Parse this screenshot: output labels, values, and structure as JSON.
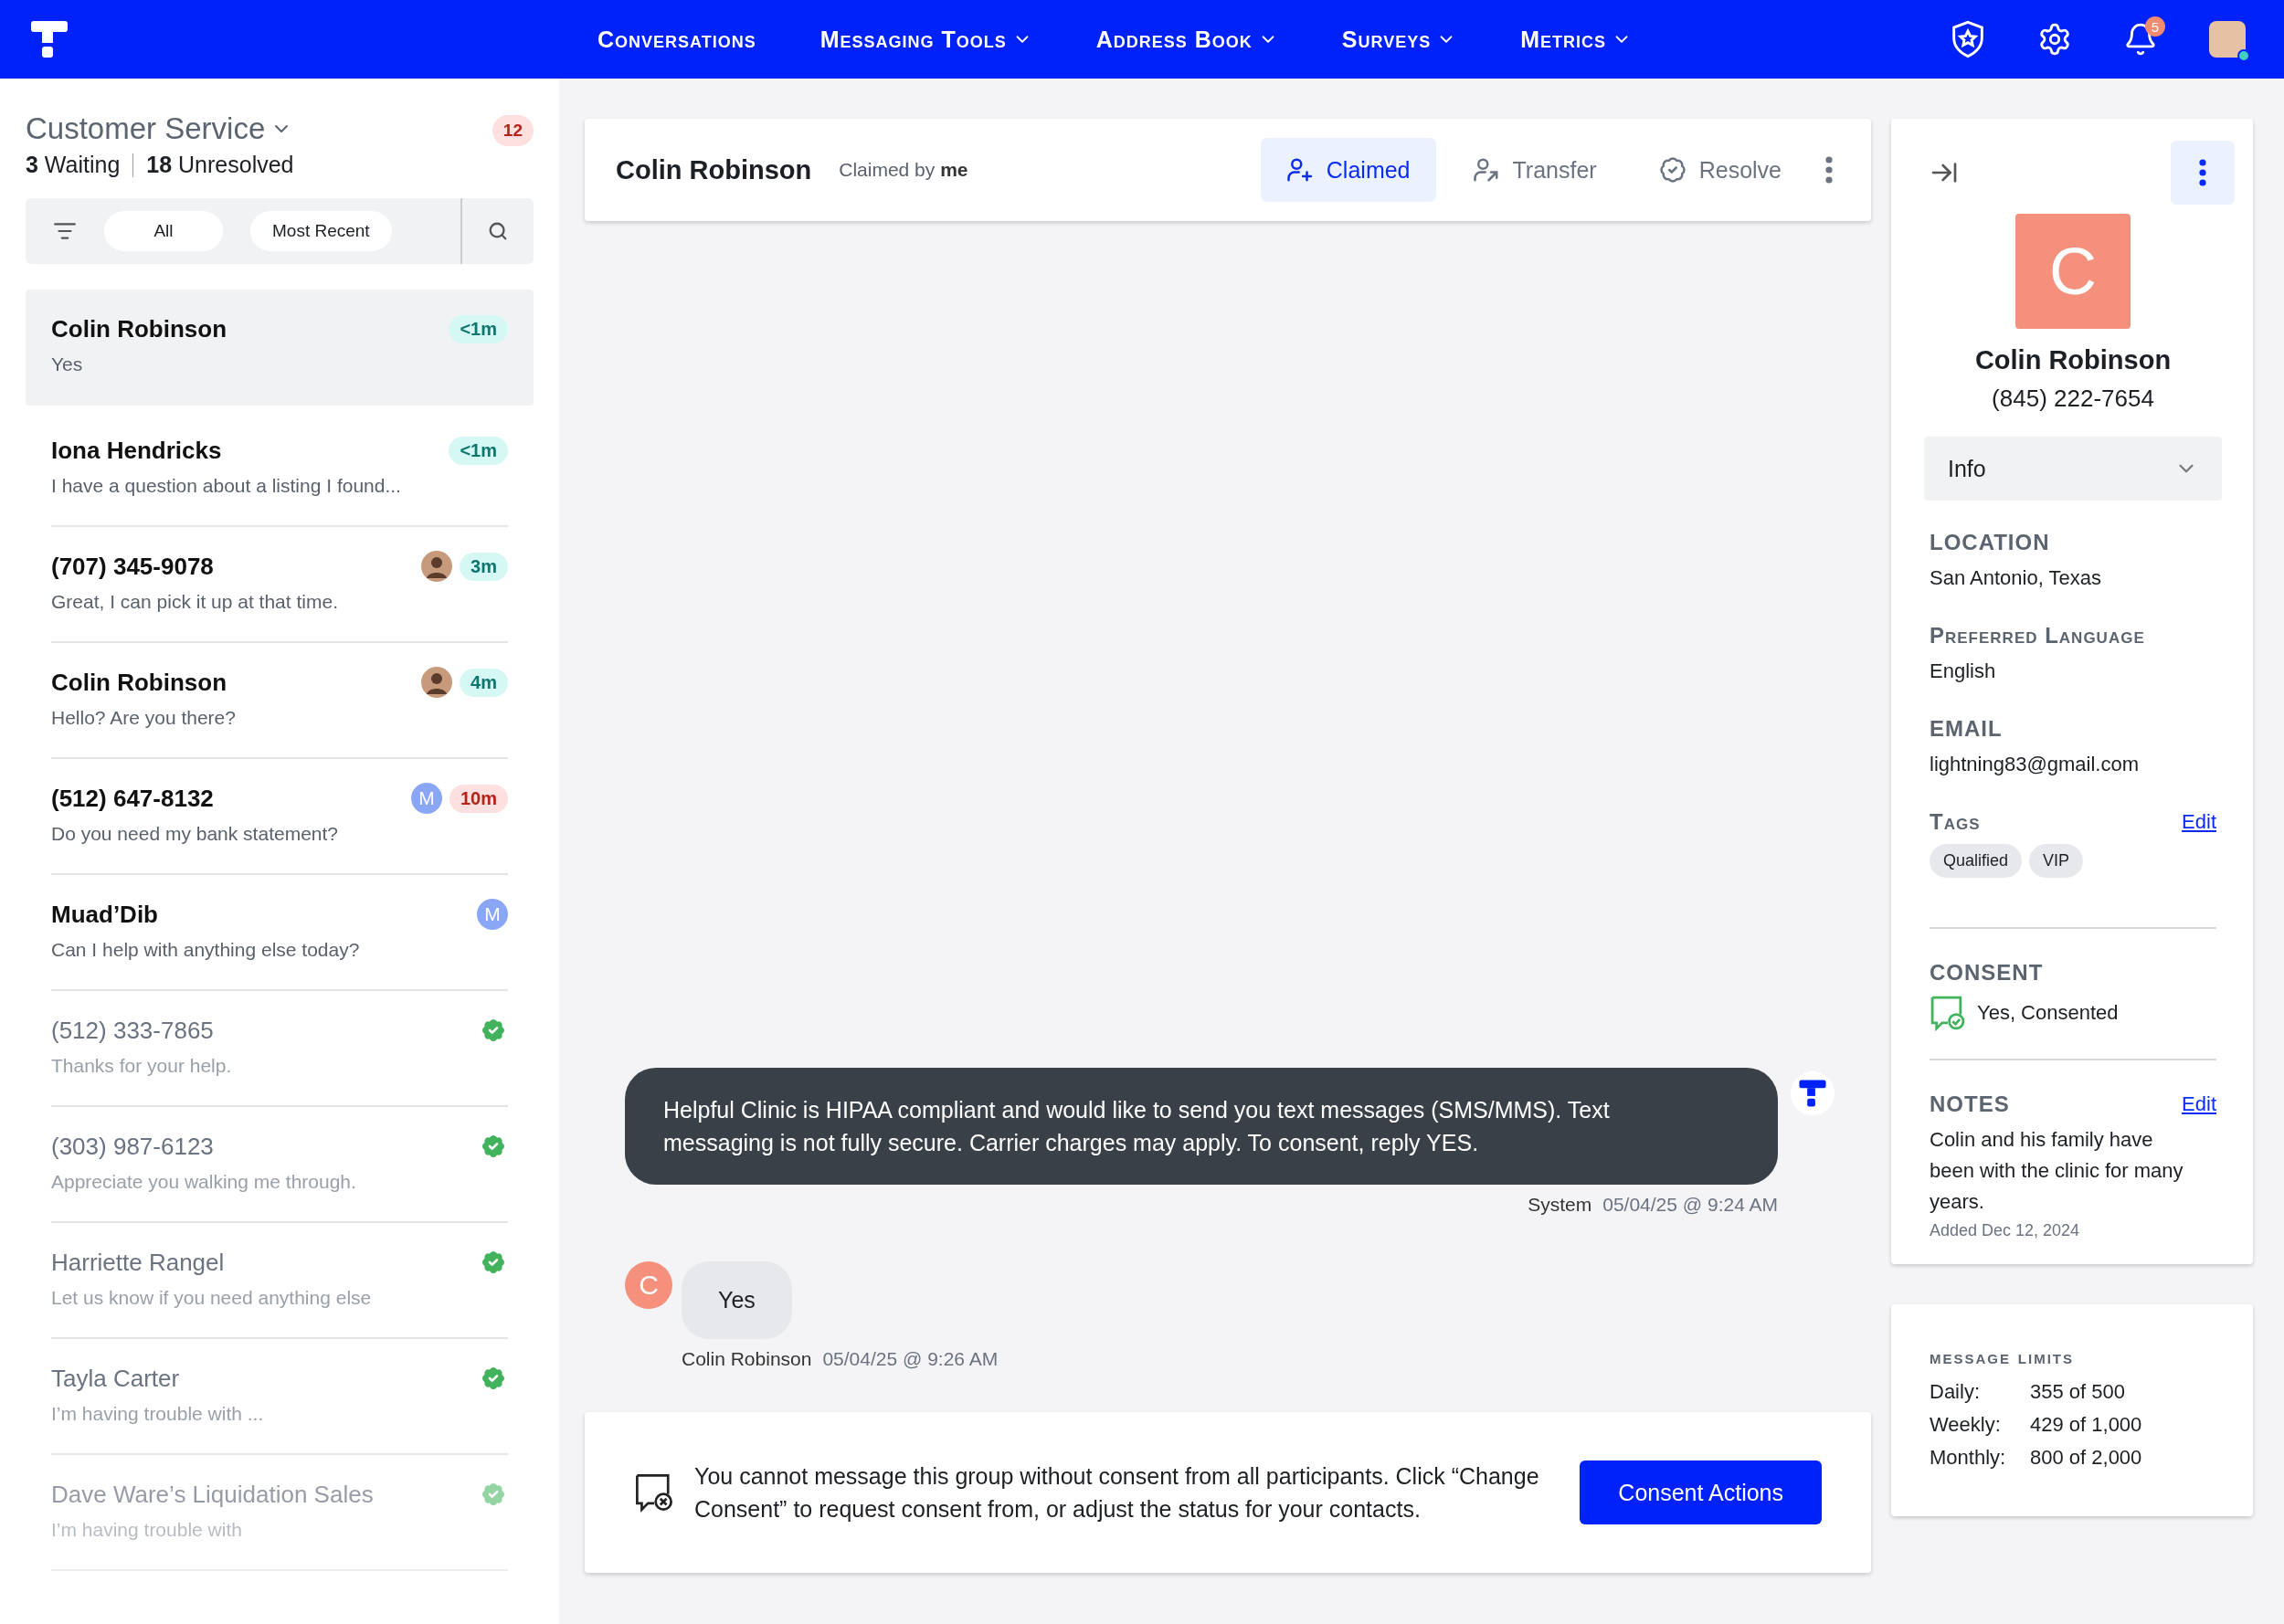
{
  "nav": {
    "items": [
      {
        "label": "Conversations",
        "dropdown": false
      },
      {
        "label": "Messaging Tools",
        "dropdown": true
      },
      {
        "label": "Address Book",
        "dropdown": true
      },
      {
        "label": "Surveys",
        "dropdown": true
      },
      {
        "label": "Metrics",
        "dropdown": true
      }
    ],
    "notification_count": "5"
  },
  "inbox": {
    "title": "Customer Service",
    "count": "12",
    "waiting": "3",
    "waiting_label": "Waiting",
    "unresolved": "18",
    "unresolved_label": "Unresolved",
    "filters": [
      {
        "label": "All"
      },
      {
        "label": "Most Recent"
      }
    ]
  },
  "conversations": [
    {
      "name": "Colin Robinson",
      "preview": "Yes",
      "time": "<1m",
      "urgent": false,
      "unread": true,
      "resolved": false,
      "faded": false,
      "selected": true
    },
    {
      "name": "Iona Hendricks",
      "preview": "I have a question about a listing I found...",
      "time": "<1m",
      "urgent": false,
      "unread": true,
      "resolved": false,
      "faded": false,
      "selected": false
    },
    {
      "name": "(707) 345-9078",
      "preview": "Great, I can pick it up at that time.",
      "time": "3m",
      "urgent": false,
      "assignee": {
        "kind": "photo"
      },
      "unread": true,
      "resolved": false,
      "faded": false,
      "selected": false
    },
    {
      "name": "Colin Robinson",
      "preview": "Hello? Are you there?",
      "time": "4m",
      "urgent": false,
      "assignee": {
        "kind": "photo"
      },
      "unread": true,
      "resolved": false,
      "faded": false,
      "selected": false
    },
    {
      "name": "(512) 647-8132",
      "preview": "Do you need my bank statement?",
      "time": "10m",
      "urgent": true,
      "assignee": {
        "kind": "initial",
        "initial": "M"
      },
      "unread": true,
      "resolved": false,
      "faded": false,
      "selected": false
    },
    {
      "name": "Muad’Dib",
      "preview": "Can I help with anything else today?",
      "assignee": {
        "kind": "initial",
        "initial": "M"
      },
      "unread": true,
      "resolved": false,
      "faded": false,
      "selected": false
    },
    {
      "name": "(512) 333-7865",
      "preview": "Thanks for your help.",
      "unread": false,
      "resolved": true,
      "faded": false,
      "selected": false
    },
    {
      "name": "(303) 987-6123",
      "preview": "Appreciate you walking me through.",
      "unread": false,
      "resolved": true,
      "faded": false,
      "selected": false
    },
    {
      "name": "Harriette Rangel",
      "preview": "Let us know if you need anything else",
      "unread": false,
      "resolved": true,
      "faded": false,
      "selected": false
    },
    {
      "name": "Tayla Carter",
      "preview": "I’m having trouble with ...",
      "unread": false,
      "resolved": true,
      "faded": false,
      "selected": false
    },
    {
      "name": "Dave Ware’s Liquidation Sales",
      "preview": "I’m having trouble with",
      "unread": false,
      "resolved": true,
      "faded": true,
      "selected": false
    }
  ],
  "chat": {
    "name": "Colin Robinson",
    "claimed_by": "Claimed by **me**",
    "actions": [
      {
        "label": "Claimed",
        "kind": "claim",
        "selected": true
      },
      {
        "label": "Transfer",
        "kind": "transfer",
        "selected": false
      },
      {
        "label": "Resolve",
        "kind": "resolve",
        "selected": false
      }
    ],
    "messages": [
      {
        "kind": "system",
        "text": "Helpful Clinic is HIPAA compliant and would like to send you text messages (SMS/MMS). Text messaging is not fully secure. Carrier charges may apply. To consent, reply YES.",
        "sender": "System",
        "time": "05/04/25 @ 9:24 AM"
      },
      {
        "kind": "contact",
        "initial": "C",
        "text": "Yes",
        "sender": "Colin Robinson",
        "time": "05/04/25 @ 9:26 AM"
      }
    ],
    "notice": {
      "text": "You cannot message this group without consent from all participants. Click “Change Consent” to request consent from, or adjust the status for your contacts.",
      "button": "Consent Actions"
    }
  },
  "contact": {
    "initial": "C",
    "name": "Colin Robinson",
    "phone": "(845) 222-7654",
    "section": "Info",
    "fields": [
      {
        "label": "LOCATION",
        "value": "San Antonio, Texas"
      },
      {
        "label": "Preferred Language",
        "value": "English"
      },
      {
        "label": "EMAIL",
        "value": "lightning83@gmail.com"
      }
    ],
    "tags": {
      "label": "Tags",
      "edit": "Edit",
      "items": [
        "Qualified",
        "VIP"
      ]
    },
    "consent": {
      "label": "CONSENT",
      "value": "Yes, Consented"
    },
    "notes": {
      "label": "NOTES",
      "edit": "Edit",
      "text": "Colin and his family have been with the clinic for many years.",
      "added": "Added Dec 12, 2024"
    }
  },
  "limits": {
    "title": "message limits",
    "rows": [
      {
        "label": "Daily:",
        "value": "355 of 500"
      },
      {
        "label": "Weekly:",
        "value": "429 of 1,000"
      },
      {
        "label": "Monthly:",
        "value": "800 of 2,000"
      }
    ]
  }
}
